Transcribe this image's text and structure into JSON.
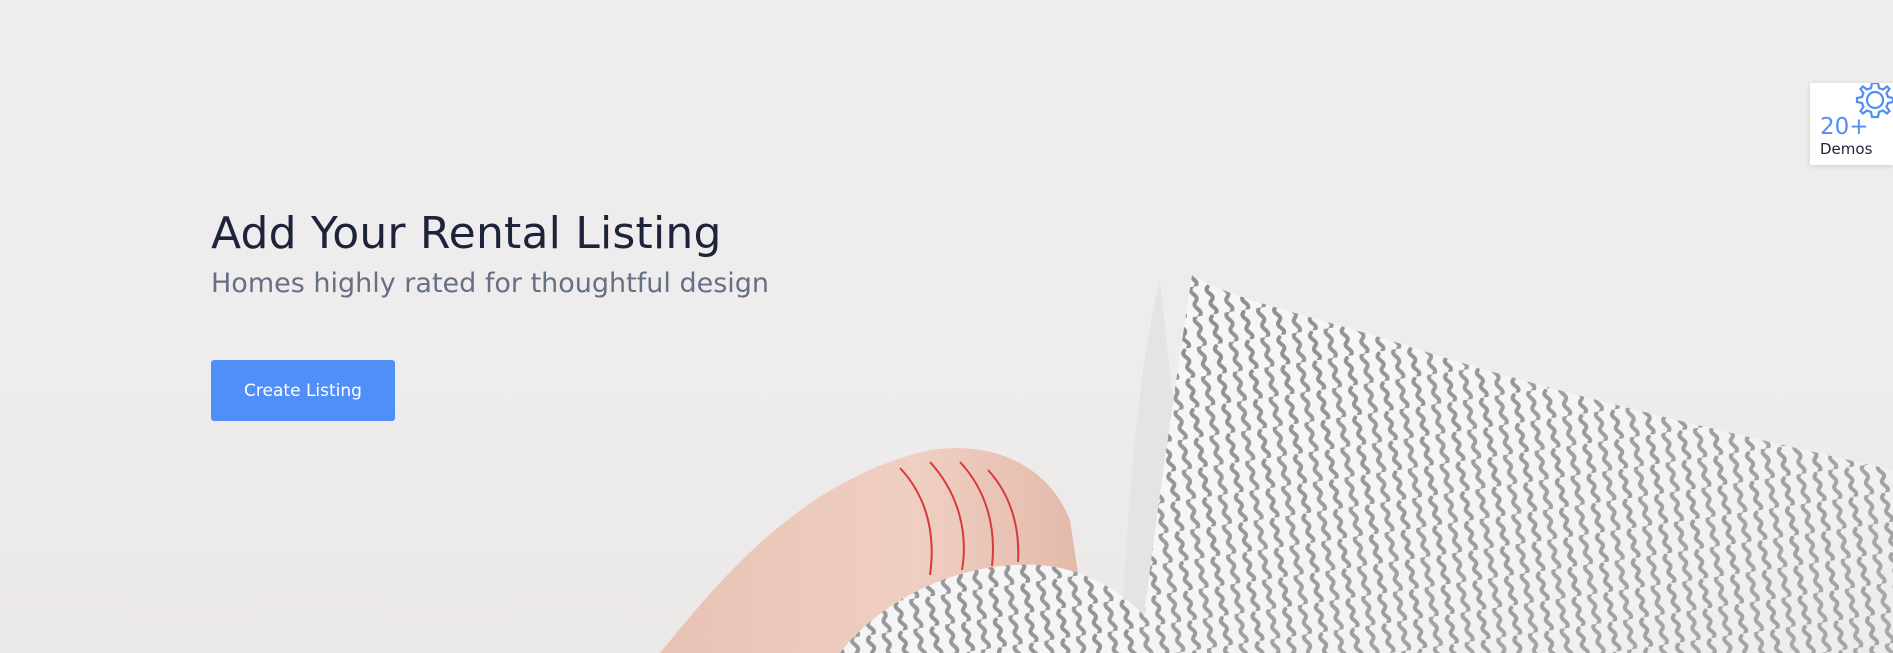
{
  "hero": {
    "title": "Add Your Rental Listing",
    "subtitle": "Homes highly rated for thoughtful design",
    "cta_label": "Create Listing",
    "background_photo": "person-arm-and-patterned-pillows-photo"
  },
  "demos_widget": {
    "count": "20+",
    "label": "Demos",
    "icon": "gear-icon"
  },
  "colors": {
    "accent": "#4f8ff7",
    "heading": "#1d2439",
    "subtitle": "#667085",
    "background": "#eeecec"
  }
}
